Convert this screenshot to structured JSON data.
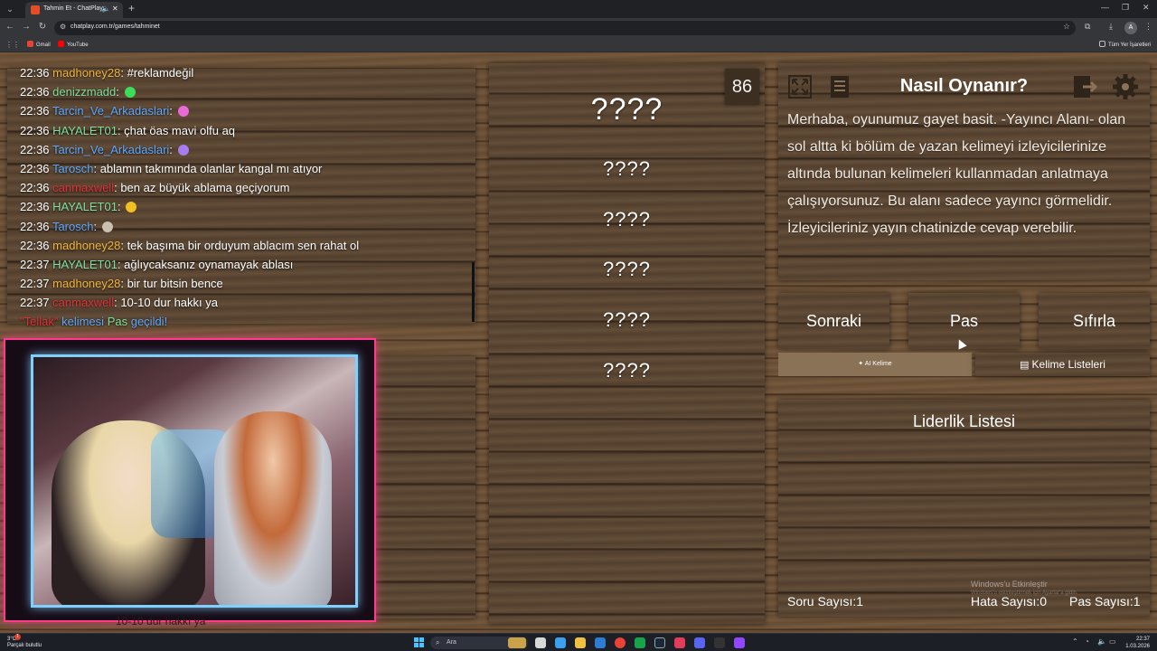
{
  "browser": {
    "tab_title": "Tahmin Et - ChatPlay",
    "url": "chatplay.com.tr/games/tahminet",
    "bookmarks": [
      "Gmail",
      "YouTube"
    ],
    "all_bookmarks": "Tüm Yer İşaretleri",
    "profile_initial": "A"
  },
  "chat": {
    "messages": [
      {
        "time": "22:36",
        "user": "madhoney28",
        "color": "#f0b43c",
        "text": ": #reklamdeğil",
        "emote": ""
      },
      {
        "time": "22:36",
        "user": "denizzmadd",
        "color": "#7ee0a0",
        "text": ": ",
        "emote": "#3ddc5a"
      },
      {
        "time": "22:36",
        "user": "Tarcin_Ve_Arkadaslari",
        "color": "#5ea8ff",
        "text": ": ",
        "emote": "#e86ad8"
      },
      {
        "time": "22:36",
        "user": "HAYALET01",
        "color": "#7ee0a0",
        "text": ": çhat öas mavi olfu aq",
        "emote": ""
      },
      {
        "time": "22:36",
        "user": "Tarcin_Ve_Arkadaslari",
        "color": "#5ea8ff",
        "text": ": ",
        "emote": "#a67cf0"
      },
      {
        "time": "22:36",
        "user": "Tarosch",
        "color": "#5ea8ff",
        "text": ": ablamın takımında olanlar kangal mı atıyor",
        "emote": ""
      },
      {
        "time": "22:36",
        "user": "canmaxwell",
        "color": "#e0303a",
        "text": ": ben az büyük ablama geçiyorum",
        "emote": ""
      },
      {
        "time": "22:36",
        "user": "HAYALET01",
        "color": "#7ee0a0",
        "text": ": ",
        "emote": "#f0c020"
      },
      {
        "time": "22:36",
        "user": "Tarosch",
        "color": "#5ea8ff",
        "text": ": ",
        "emote": "#c8c0b0"
      },
      {
        "time": "22:36",
        "user": "madhoney28",
        "color": "#f0b43c",
        "text": ": tek başıma bir orduyum ablacım sen rahat ol",
        "emote": ""
      },
      {
        "time": "22:37",
        "user": "HAYALET01",
        "color": "#7ee0a0",
        "text": ": ağlıycaksanız oynamayak ablası",
        "emote": ""
      },
      {
        "time": "22:37",
        "user": "madhoney28",
        "color": "#f0b43c",
        "text": ": bir tur bitsin bence",
        "emote": ""
      },
      {
        "time": "22:37",
        "user": "canmaxwell",
        "color": "#e0303a",
        "text": ": 10-10 dur hakkı ya",
        "emote": ""
      }
    ],
    "system": {
      "word": "\"Tellak\"",
      "mid": "kelimesi",
      "action": "Pas",
      "tail": "geçildi!"
    },
    "overlap_text": "10-10 dur hakkı ya"
  },
  "game": {
    "timer": "86",
    "main_word": "????",
    "hidden_words": [
      "????",
      "????",
      "????",
      "????",
      "????"
    ],
    "how_to_title": "Nasıl Oynanır?",
    "how_to_text": "Merhaba, oyunumuz gayet basit. -Yayıncı Alanı- olan sol altta ki bölüm de yazan kelimeyi izleyicilerinize altında bulunan kelimeleri kullanmadan anlatmaya çalışıyorsunuz. Bu alanı sadece yayıncı görmelidir. İzleyicileriniz yayın chatinizde cevap verebilir.",
    "buttons": {
      "next": "Sonraki",
      "pass": "Pas",
      "reset": "Sıfırla"
    },
    "ai_word": "AI Kelime",
    "word_lists": "Kelime Listeleri",
    "leaderboard_title": "Liderlik Listesi",
    "stats": {
      "questions": "Soru Sayısı:1",
      "errors": "Hata Sayısı:0",
      "passes": "Pas Sayısı:1"
    },
    "watermark": "Windows'u Etkinleştir",
    "watermark_sub": "Windows'u etkinleştirmek için Ayarlar'a gidin."
  },
  "taskbar": {
    "weather_temp": "3°C",
    "weather_desc": "Parçalı bulutlu",
    "badge": "1",
    "search_placeholder": "Ara",
    "time": "22:37",
    "date": "1.03.2026"
  },
  "colors": {
    "system_word": "#e0303a",
    "system_mid": "#5ea8ff",
    "system_action": "#7ee0a0",
    "system_tail": "#5ea8ff",
    "ai_word_bg": "#8a7256",
    "neon_pink": "#ff3a8c",
    "neon_blue": "#7fd0ff"
  }
}
